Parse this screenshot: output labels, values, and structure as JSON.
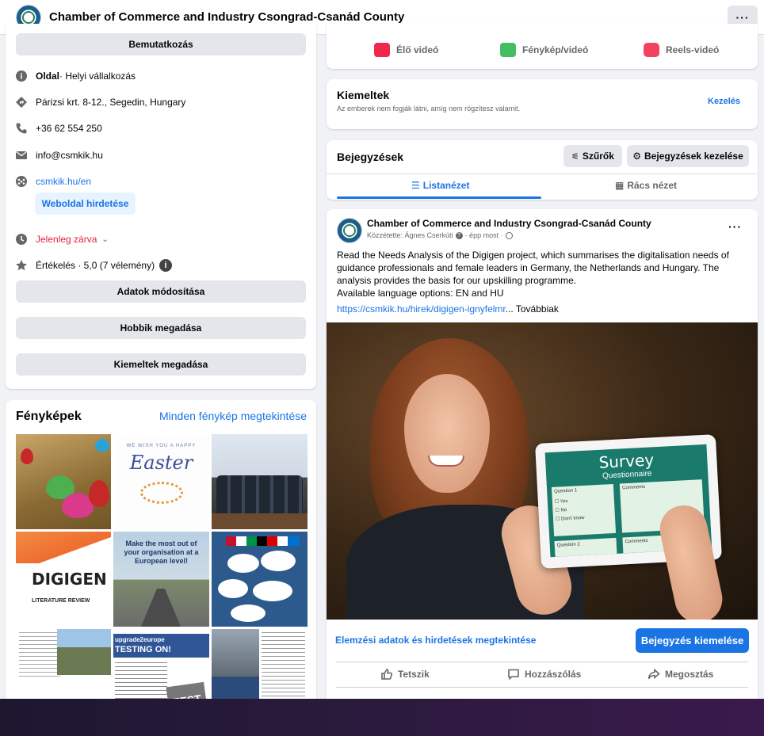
{
  "header": {
    "title": "Chamber of Commerce and Industry Csongrad-Csanád County",
    "more_label": "···"
  },
  "intro": {
    "intro_button": "Bemutatkozás",
    "page_type_bold": "Oldal",
    "page_type_rest": " · Helyi vállalkozás",
    "address": "Párizsi krt. 8-12., Segedin, Hungary",
    "phone": "+36 62 554 250",
    "email": "info@csmkik.hu",
    "website": "csmkik.hu/en",
    "promote_website": "Weboldal hirdetése",
    "status": "Jelenleg zárva",
    "rating": "Értékelés · 5,0 (7 vélemény)",
    "edit_details": "Adatok módosítása",
    "add_hobbies": "Hobbik megadása",
    "add_featured": "Kiemeltek megadása"
  },
  "photos": {
    "title": "Fényképek",
    "see_all": "Minden fénykép megtekintése",
    "tiles": {
      "easter_small": "WE WISH YOU A HAPPY",
      "easter_big": "Easter",
      "digigen": "DIGIGEN",
      "literature": "LITERATURE REVIEW",
      "make_most": "Make the most out of your organisation at a European level!",
      "upgrade": "upgrade2europe",
      "testing": "TESTING ON!",
      "test": "TEST"
    }
  },
  "create": {
    "live": "Élő videó",
    "photo": "Fénykép/videó",
    "reels": "Reels-videó"
  },
  "highlights": {
    "title": "Kiemeltek",
    "subtitle": "Az emberek nem fogják látni, amíg nem rögzítesz valamit.",
    "manage": "Kezelés"
  },
  "posts": {
    "title": "Bejegyzések",
    "filters": "Szűrők",
    "manage_posts": "Bejegyzések kezelése",
    "list_view": "Listanézet",
    "grid_view": "Rács nézet"
  },
  "post": {
    "author": "Chamber of Commerce and Industry Csongrad-Csanád County",
    "meta_prefix": "Közzétette: Ágnes Cserkúti",
    "meta_time": "· épp most ·",
    "text_line1": "Read the Needs Analysis of the Digigen project, which summarises the digitalisation needs of",
    "text_line2": "guidance professionals and female leaders in Germany, the Netherlands and Hungary. The",
    "text_line3": "analysis provides the basis for our upskilling programme.",
    "text_line4": "Available language options: EN and HU",
    "link": "https://csmkik.hu/hirek/digigen-ignyfelmr",
    "more": "... Továbbiak",
    "image": {
      "survey": "Survey",
      "questionnaire": "Questionnaire",
      "q1": "Question 1",
      "comments": "Comments",
      "yes": "Yes",
      "no": "No",
      "dont_know": "Don't know",
      "q2": "Question 2"
    },
    "insights": "Elemzési adatok és hirdetések megtekintése",
    "boost": "Bejegyzés kiemelése",
    "like": "Tetszik",
    "comment": "Hozzászólás",
    "share": "Megosztás"
  },
  "colors": {
    "accent": "#1b74e4",
    "closed": "#e41e3f",
    "page_bg": "#f0f2f5"
  }
}
